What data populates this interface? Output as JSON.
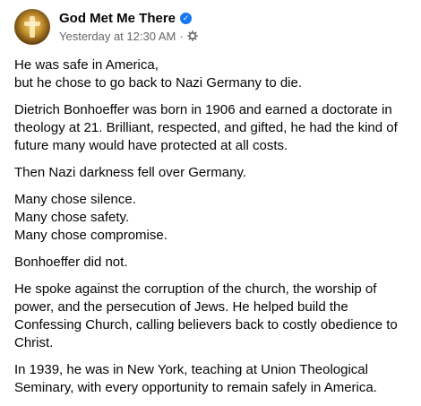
{
  "header": {
    "page_name": "God Met Me There",
    "verified_icon": "verified-badge-icon",
    "timestamp": "Yesterday at 12:30 AM",
    "separator": "·",
    "audience_icon": "gear-icon"
  },
  "post": {
    "paragraphs": [
      "He was safe in America,\nbut he chose to go back to Nazi Germany to die.",
      "Dietrich Bonhoeffer was born in 1906 and earned a doctorate in theology at 21. Brilliant, respected, and gifted, he had the kind of future many would have protected at all costs.",
      "Then Nazi darkness fell over Germany.",
      "Many chose silence.\nMany chose safety.\nMany chose compromise.",
      "Bonhoeffer did not.",
      "He spoke against the corruption of the church, the worship of power, and the persecution of Jews. He helped build the Confessing Church, calling believers back to costly obedience to Christ.",
      "In 1939, he was in New York, teaching at Union Theological Seminary, with every opportunity to remain safely in America."
    ]
  },
  "colors": {
    "text": "#050505",
    "secondary": "#65676b",
    "verified": "#1877f2"
  }
}
